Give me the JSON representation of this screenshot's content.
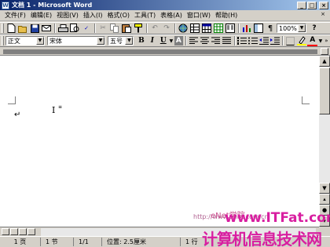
{
  "window": {
    "title": "文档 1 - Microsoft Word",
    "app_icon": "W",
    "minimize": "_",
    "maximize": "□",
    "close": "×"
  },
  "menubar": {
    "items": [
      "文件(F)",
      "编辑(E)",
      "视图(V)",
      "插入(I)",
      "格式(O)",
      "工具(T)",
      "表格(A)",
      "窗口(W)",
      "帮助(H)"
    ],
    "doc_close": "×"
  },
  "toolbar_standard": {
    "icons": [
      "new-icon",
      "open-icon",
      "save-icon",
      "email-icon",
      "print-icon",
      "preview-icon",
      "spelling-icon",
      "cut-icon",
      "copy-icon",
      "paste-icon",
      "format-painter-icon",
      "undo-icon",
      "redo-icon",
      "hyperlink-icon",
      "tables-borders-icon",
      "insert-table-icon",
      "insert-excel-icon",
      "columns-icon",
      "drawing-icon",
      "doc-map-icon",
      "show-hide-icon"
    ],
    "zoom": "100%",
    "help": "?"
  },
  "toolbar_format": {
    "style": "正文",
    "font": "宋体",
    "size": "五号",
    "bold": "B",
    "italic": "I",
    "underline": "U",
    "char_border": "A",
    "font_color": "A"
  },
  "document": {
    "paragraph_mark": "↵",
    "ibeam": "I",
    "ibeam_tag": "≡"
  },
  "status": {
    "page": "1 页",
    "section": "1 节",
    "page_of": "1/1",
    "position": "位置: 2.5厘米",
    "line": "1 行"
  },
  "watermark": {
    "text1": "eNet学院",
    "text2": "www.ITFat.com",
    "text3": "http://www.enet.com.cn",
    "text4": "计算机信息技术网"
  },
  "colors": {
    "title_gradient_start": "#0a246a",
    "title_gradient_end": "#a6caf0",
    "chrome": "#d4d0c8",
    "watermark": "#d81ea0"
  }
}
